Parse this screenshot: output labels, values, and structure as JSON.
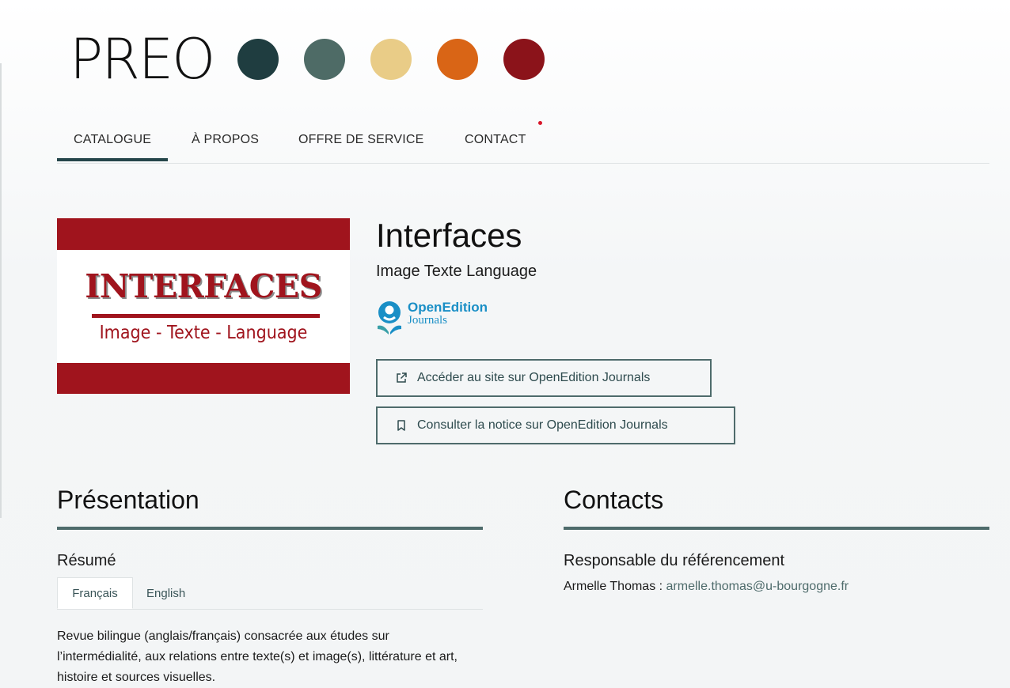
{
  "header": {
    "logo_text": "PREO",
    "logo_dot_colors": [
      "#1f3d40",
      "#4e6b66",
      "#e9cc87",
      "#d96516",
      "#8b131a"
    ]
  },
  "nav": {
    "items": [
      {
        "label": "CATALOGUE",
        "active": true
      },
      {
        "label": "À PROPOS",
        "active": false
      },
      {
        "label": "OFFRE DE SERVICE",
        "active": false
      },
      {
        "label": "CONTACT",
        "active": false
      }
    ]
  },
  "journal": {
    "cover_title": "INTERFACES",
    "cover_subtitle": "Image - Texte - Language",
    "title": "Interfaces",
    "subtitle": "Image Texte Language",
    "platform_logo": {
      "name": "OpenEdition",
      "sub": "Journals"
    },
    "buttons": {
      "visit": "Accéder au site sur OpenEdition Journals",
      "notice": "Consulter la notice sur OpenEdition Journals"
    }
  },
  "presentation": {
    "heading": "Présentation",
    "resume_label": "Résumé",
    "tabs": [
      "Français",
      "English"
    ],
    "active_tab": "Français",
    "abstract": "Revue bilingue (anglais/français) consacrée aux études sur l’intermédialité, aux relations entre texte(s) et image(s), littérature et art, histoire et sources visuelles."
  },
  "contacts": {
    "heading": "Contacts",
    "role": "Responsable du référencement",
    "name": "Armelle Thomas :",
    "email": "armelle.thomas@u-bourgogne.fr"
  },
  "colors": {
    "accent": "#4e6b6b",
    "nav_active": "#25464a",
    "cover_red": "#a0141d",
    "openedition_blue": "#1a8fc6"
  }
}
